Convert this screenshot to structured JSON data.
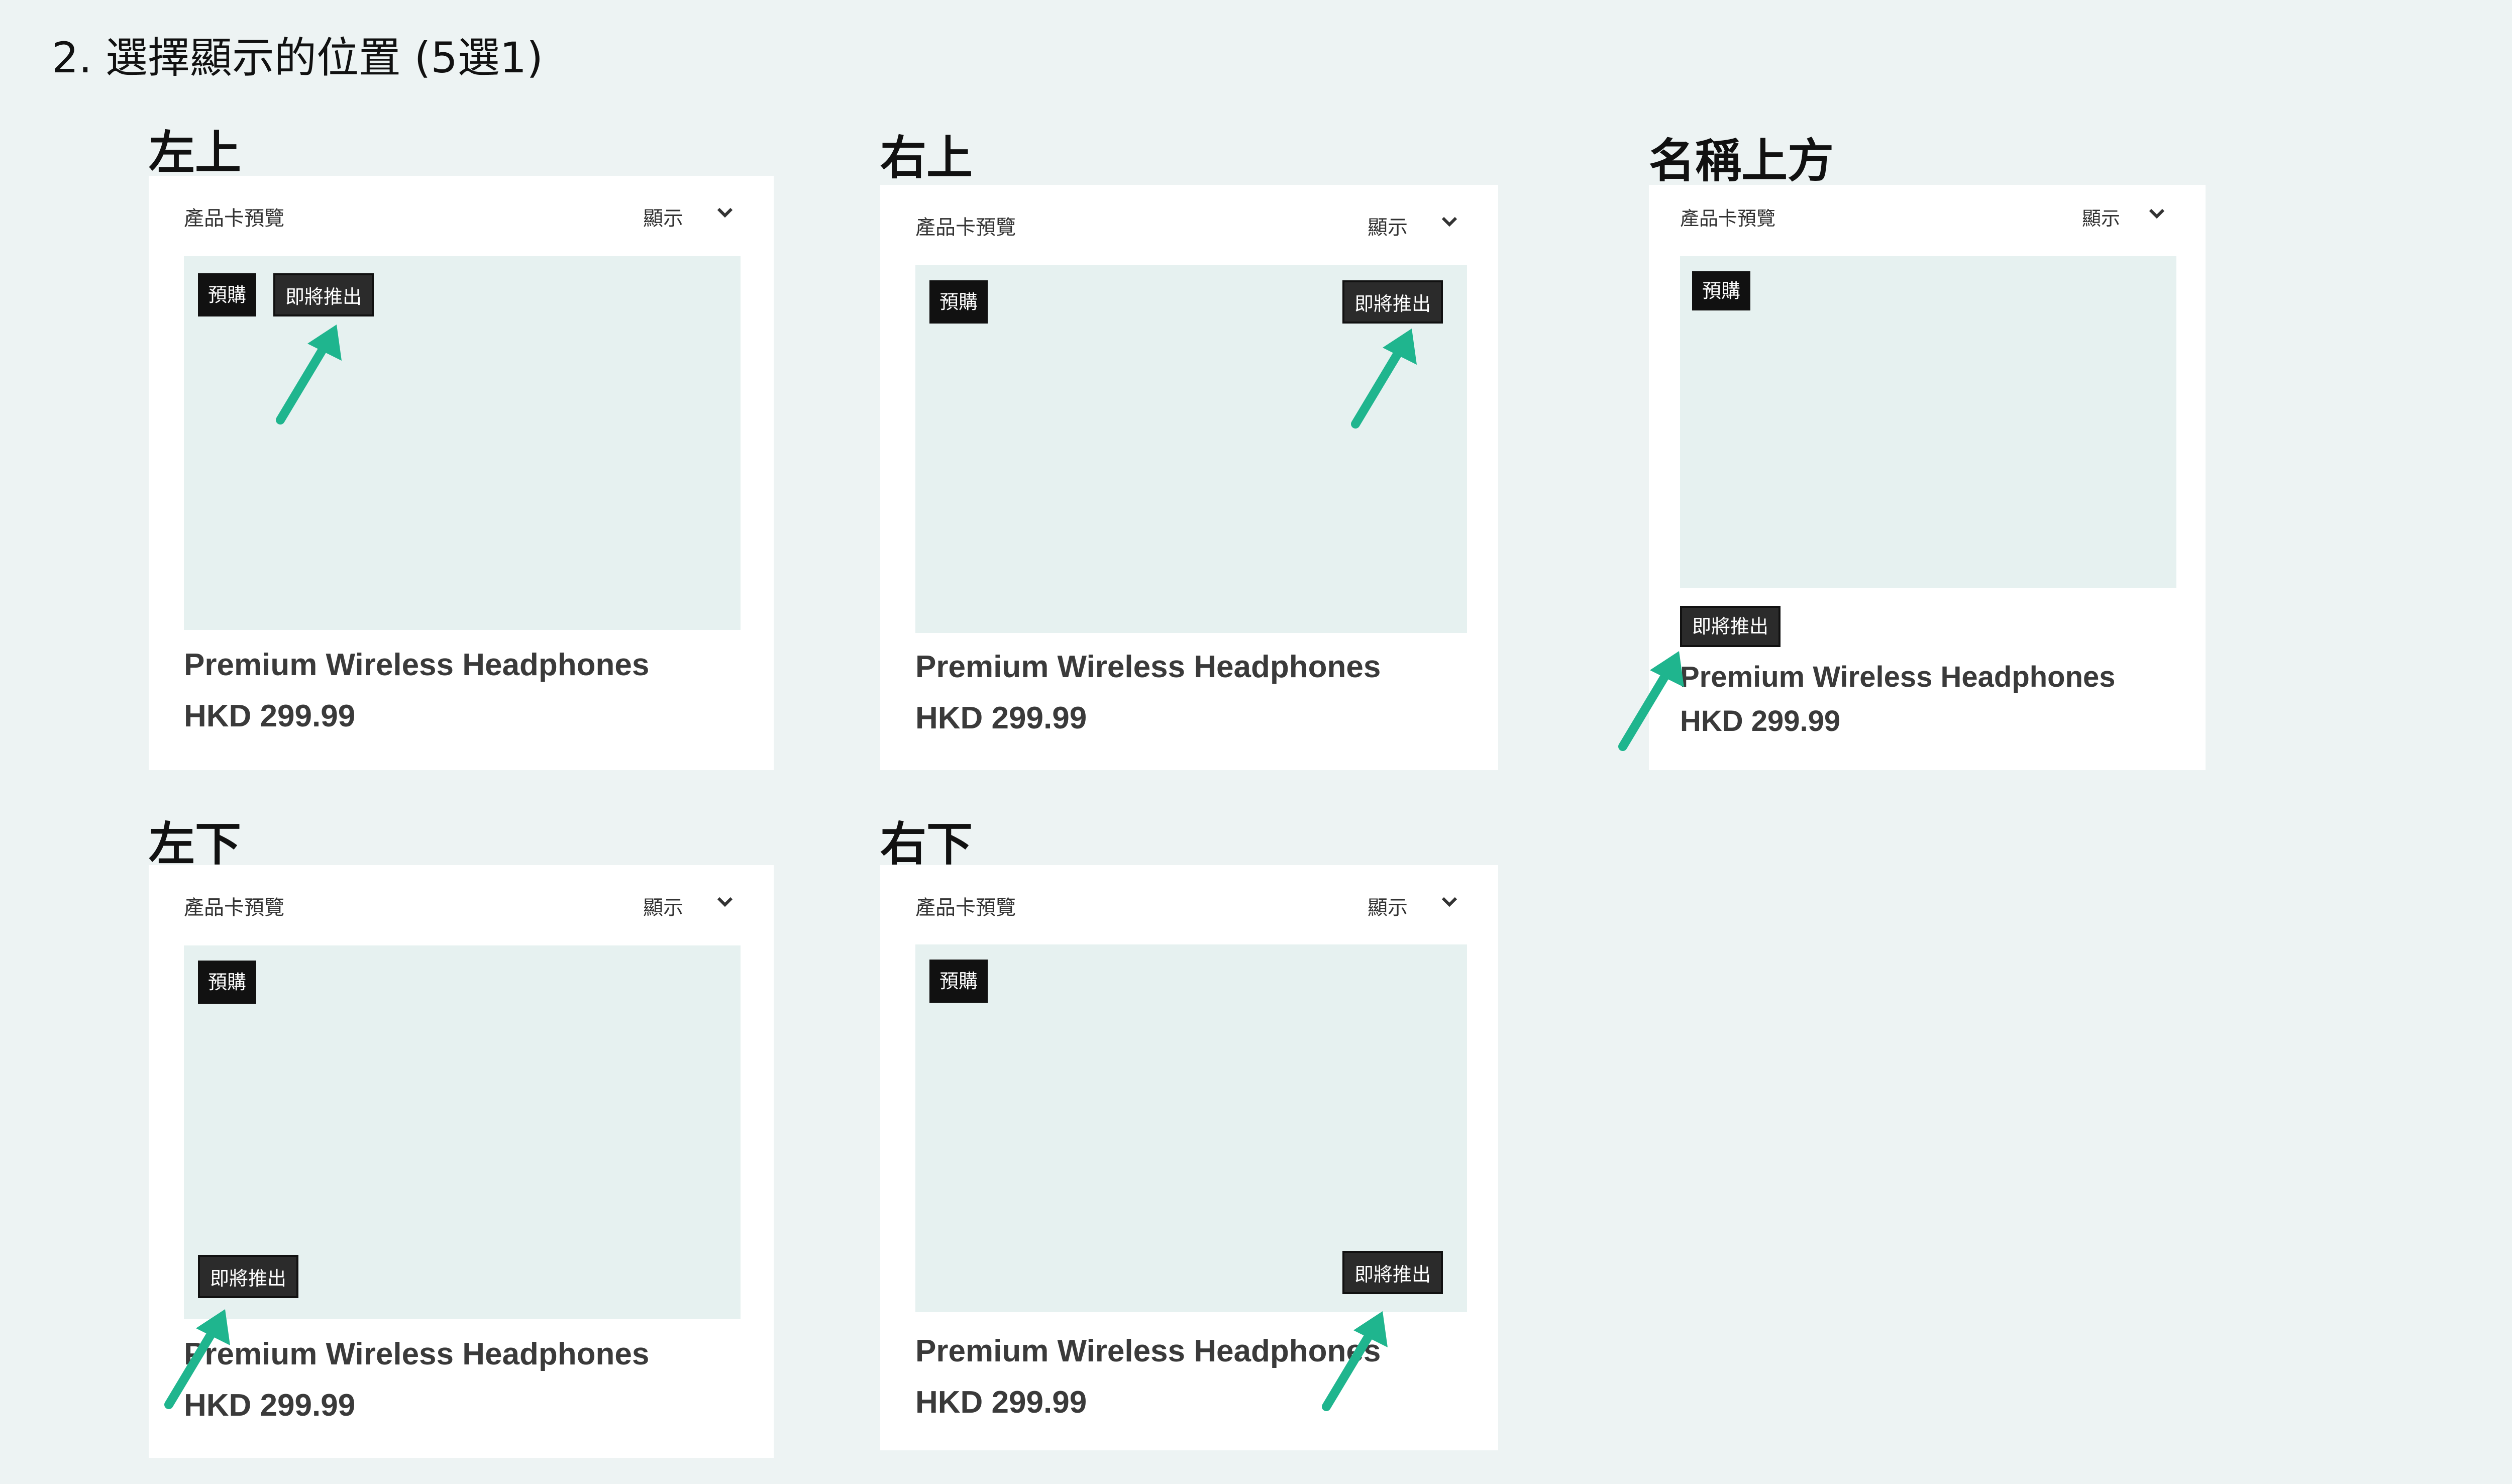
{
  "page": {
    "title": "2. 選擇顯示的位置 (5選1)"
  },
  "colors": {
    "background": "#edf3f3",
    "card": "#ffffff",
    "image_placeholder": "#e6f1f0",
    "tag": "#111111",
    "arrow": "#1fb58e"
  },
  "card_common": {
    "header_title": "產品卡預覽",
    "header_toggle": "顯示",
    "preorder_tag": "預購",
    "coming_soon_tag": "即將推出",
    "product_name": "Premium Wireless Headphones",
    "product_price": "HKD 299.99"
  },
  "options": [
    {
      "label": "左上"
    },
    {
      "label": "右上"
    },
    {
      "label": "名稱上方"
    },
    {
      "label": "左下"
    },
    {
      "label": "右下"
    }
  ],
  "icons": {
    "dropdown": "chevron-down-icon",
    "pointer": "arrow-up-right-icon"
  }
}
